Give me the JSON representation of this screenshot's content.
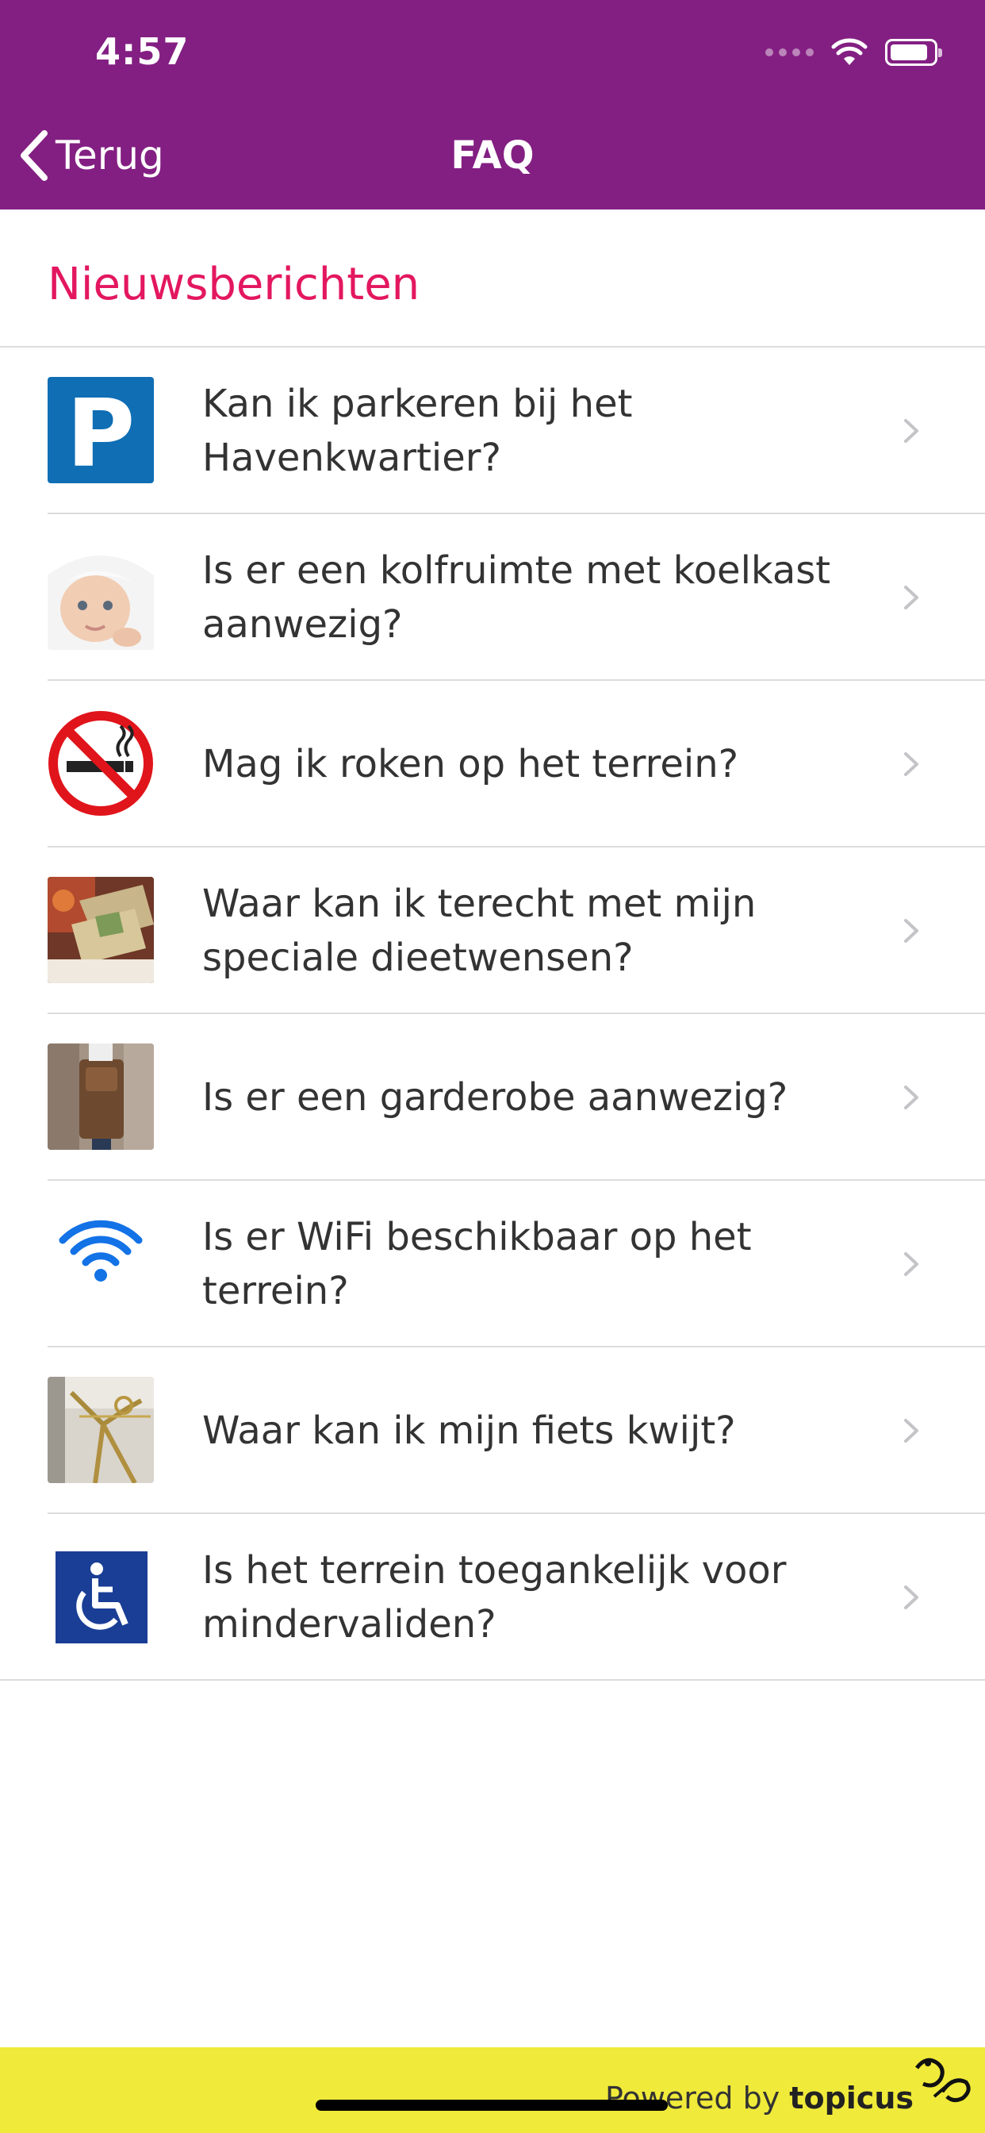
{
  "status_bar": {
    "time": "4:57"
  },
  "nav": {
    "back_label": "Terug",
    "title": "FAQ"
  },
  "section": {
    "title": "Nieuwsberichten"
  },
  "faq_items": [
    {
      "icon": "parking-sign-icon",
      "label": "Kan ik parkeren bij het Havenkwartier?"
    },
    {
      "icon": "baby-photo-icon",
      "label": "Is er een kolfruimte met koelkast aanwezig?"
    },
    {
      "icon": "no-smoking-icon",
      "label": "Mag ik roken op het terrein?"
    },
    {
      "icon": "food-photo-icon",
      "label": "Waar kan ik terecht met mijn speciale dieetwensen?"
    },
    {
      "icon": "backpack-photo-icon",
      "label": "Is er een garderobe aanwezig?"
    },
    {
      "icon": "wifi-icon",
      "label": "Is er WiFi beschikbaar op het terrein?"
    },
    {
      "icon": "bicycle-photo-icon",
      "label": "Waar kan ik mijn fiets kwijt?"
    },
    {
      "icon": "wheelchair-icon",
      "label": "Is het terrein toegankelijk voor mindervaliden?"
    }
  ],
  "footer": {
    "powered_prefix": "Powered by",
    "brand": "topicus"
  },
  "colors": {
    "header": "#831f82",
    "section_title": "#e3175f",
    "footer": "#f0ea3a",
    "parking": "#0f6eb4",
    "wheelchair": "#1a3e96"
  }
}
